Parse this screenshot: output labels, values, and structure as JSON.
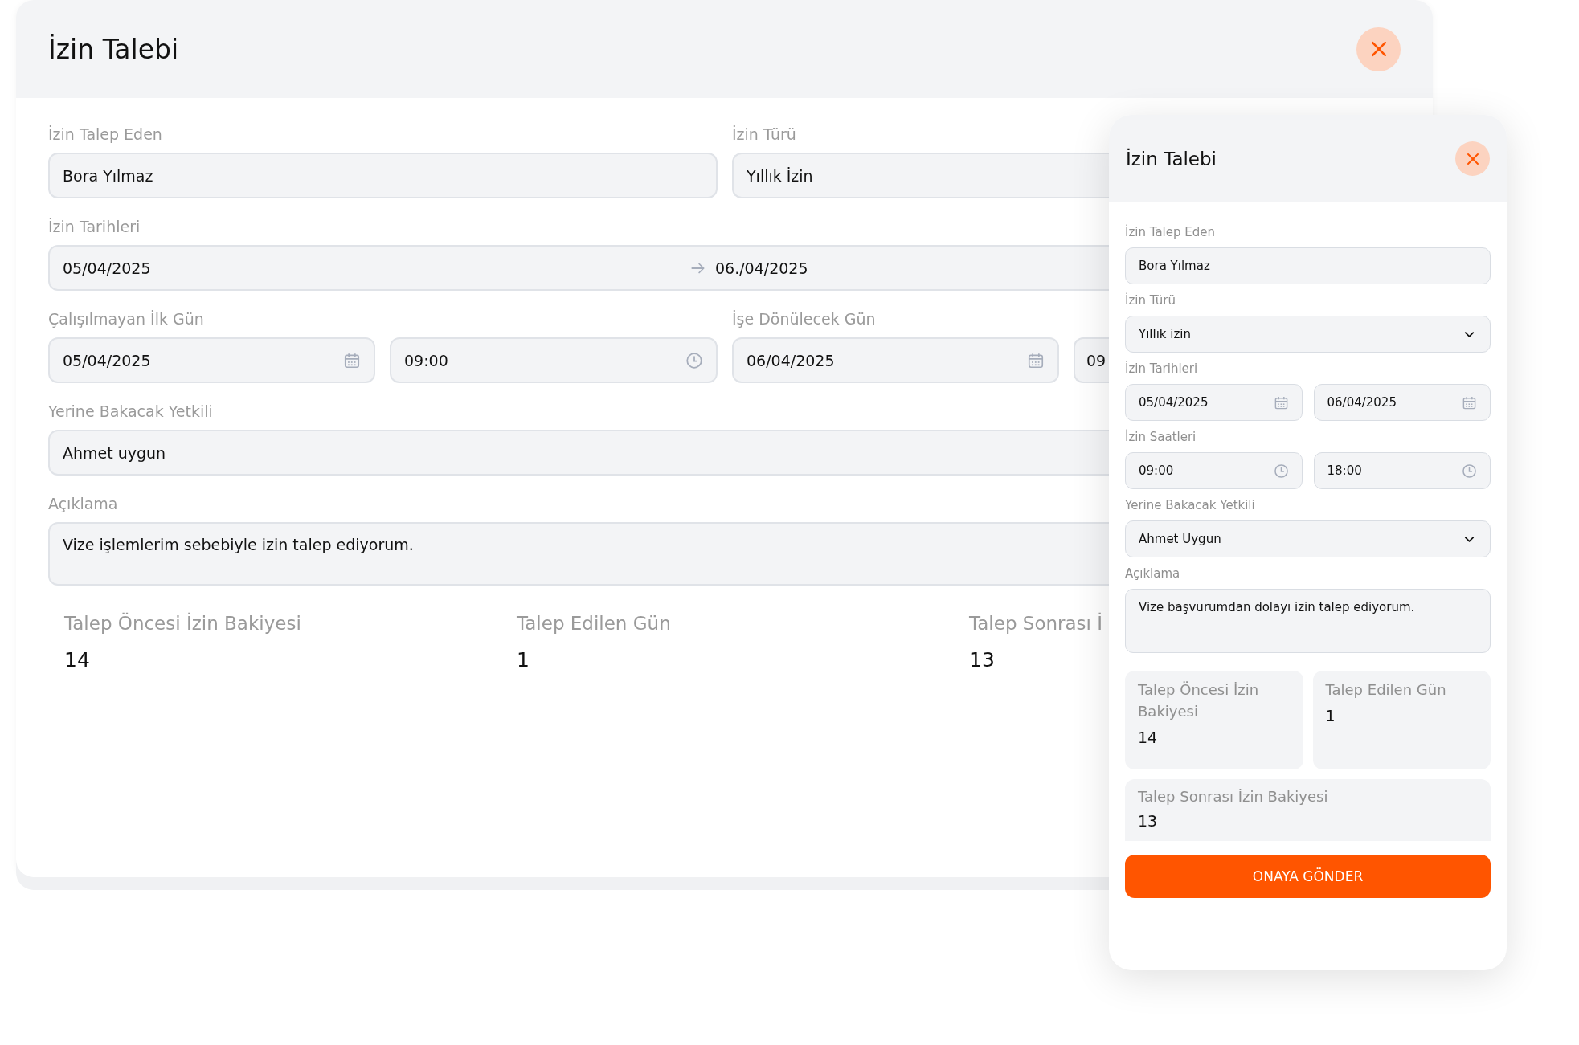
{
  "main_dialog": {
    "title": "İzin Talebi",
    "rows": [
      [
        {
          "label": "İzin Talep Eden",
          "fields": [
            {
              "kind": "text",
              "value": "Bora Yılmaz"
            }
          ]
        },
        {
          "label": "İzin Türü",
          "fields": [
            {
              "kind": "text",
              "value": "Yıllık İzin"
            }
          ]
        }
      ],
      [
        {
          "label": "İzin Tarihleri",
          "fields": [
            {
              "kind": "range",
              "value": "05/04/2025",
              "end": "06./04/2025"
            }
          ]
        }
      ],
      [
        {
          "label": "Çalışılmayan İlk Gün",
          "fields": [
            {
              "kind": "date",
              "value": "05/04/2025"
            },
            {
              "kind": "time",
              "value": "09:00"
            }
          ]
        },
        {
          "label": "İşe Dönülecek Gün",
          "fields": [
            {
              "kind": "date",
              "value": "06/04/2025"
            },
            {
              "kind": "time",
              "value": "09"
            }
          ]
        }
      ],
      [
        {
          "label": "Yerine Bakacak Yetkili",
          "fields": [
            {
              "kind": "text",
              "value": "Ahmet uygun"
            }
          ]
        }
      ],
      [
        {
          "label": "Açıklama",
          "fields": [
            {
              "kind": "textarea",
              "value": "Vize işlemlerim sebebiyle izin talep ediyorum."
            }
          ]
        }
      ]
    ],
    "stats": [
      {
        "label": "Talep Öncesi İzin Bakiyesi",
        "value": "14"
      },
      {
        "label": "Talep Edilen Gün",
        "value": "1"
      },
      {
        "label": "Talep Sonrası İ",
        "value": "13"
      }
    ]
  },
  "side_dialog": {
    "title": "İzin Talebi",
    "sections": [
      {
        "label": "İzin Talep Eden",
        "fields": [
          {
            "kind": "text",
            "value": "Bora Yılmaz"
          }
        ]
      },
      {
        "label": "İzin Türü",
        "fields": [
          {
            "kind": "select",
            "value": "Yıllık izin"
          }
        ]
      },
      {
        "label": "İzin Tarihleri",
        "fields": [
          {
            "kind": "date",
            "value": "05/04/2025"
          },
          {
            "kind": "date",
            "value": "06/04/2025"
          }
        ]
      },
      {
        "label": "İzin Saatleri",
        "fields": [
          {
            "kind": "time",
            "value": "09:00"
          },
          {
            "kind": "time",
            "value": "18:00"
          }
        ]
      },
      {
        "label": "Yerine Bakacak Yetkili",
        "fields": [
          {
            "kind": "select",
            "value": "Ahmet Uygun"
          }
        ]
      },
      {
        "label": "Açıklama",
        "fields": [
          {
            "kind": "textarea",
            "value": "Vize başvurumdan dolayı izin talep ediyorum."
          }
        ]
      }
    ],
    "stats": [
      {
        "label": "Talep Öncesi İzin Bakiyesi",
        "value": "14"
      },
      {
        "label": "Talep Edilen Gün",
        "value": "1"
      },
      {
        "label": "Talep Sonrası İzin Bakiyesi",
        "value": "13"
      }
    ],
    "submit_button": "ONAYA GÖNDER"
  }
}
